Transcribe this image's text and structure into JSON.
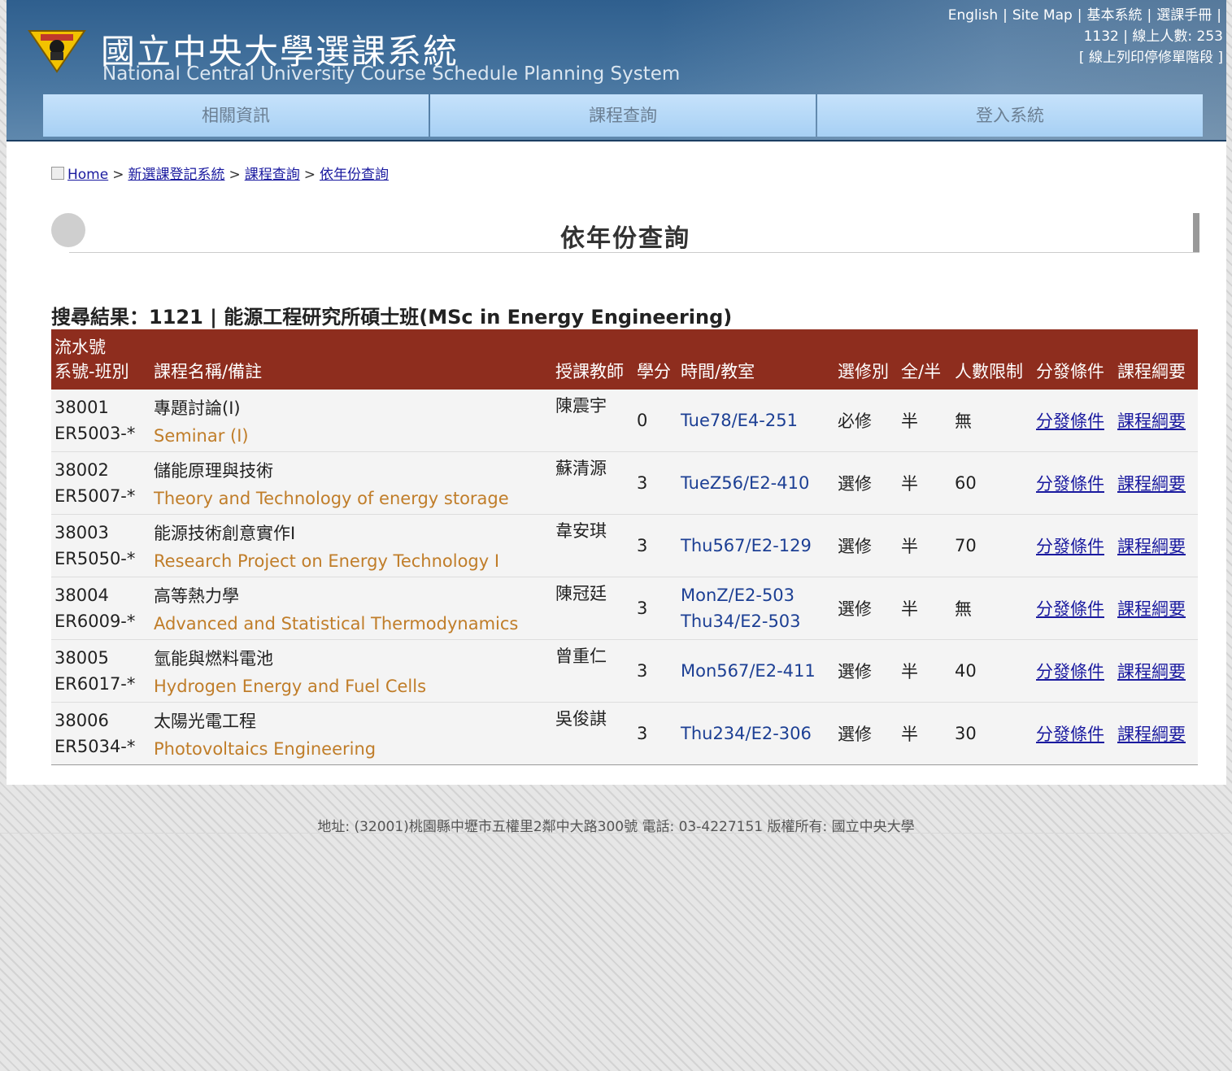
{
  "header": {
    "title_zh": "國立中央大學選課系統",
    "title_en": "National Central University Course Schedule Planning System",
    "top_links": [
      "English",
      "Site Map",
      "基本系統",
      "選課手冊"
    ],
    "online": "1132 | 線上人數: 253",
    "print_stop": "[ 線上列印停修單階段 ]"
  },
  "nav": [
    "相關資訊",
    "課程查詢",
    "登入系統"
  ],
  "breadcrumb": [
    "Home",
    "新選課登記系統",
    "課程查詢",
    "依年份查詢"
  ],
  "section_title": "依年份查詢",
  "result_title": "搜尋結果：1121 | 能源工程研究所碩士班(MSc in Energy Engineering)",
  "table": {
    "headers": [
      "流水號",
      "系號-班別",
      "課程名稱/備註",
      "授課教師",
      "學分",
      "時間/教室",
      "選修別",
      "全/半",
      "人數限制",
      "分發條件",
      "課程綱要"
    ],
    "link_condition": "分發條件",
    "link_outline": "課程綱要",
    "rows": [
      {
        "serial": "38001",
        "code": "ER5003-*",
        "name_zh": "專題討論(I)",
        "name_en": "Seminar (I)",
        "teacher": "陳震宇",
        "credit": "0",
        "time": "Tue78/E4-251",
        "type": "必修",
        "half": "半",
        "limit": "無"
      },
      {
        "serial": "38002",
        "code": "ER5007-*",
        "name_zh": "儲能原理與技術",
        "name_en": "Theory and Technology of energy storage",
        "teacher": "蘇清源",
        "credit": "3",
        "time": "TueZ56/E2-410",
        "type": "選修",
        "half": "半",
        "limit": "60"
      },
      {
        "serial": "38003",
        "code": "ER5050-*",
        "name_zh": "能源技術創意實作I",
        "name_en": "Research Project on Energy Technology I",
        "teacher": "韋安琪",
        "credit": "3",
        "time": "Thu567/E2-129",
        "type": "選修",
        "half": "半",
        "limit": "70"
      },
      {
        "serial": "38004",
        "code": "ER6009-*",
        "name_zh": "高等熱力學",
        "name_en": "Advanced and Statistical Thermodynamics",
        "teacher": "陳冠廷",
        "credit": "3",
        "time": "MonZ/E2-503",
        "time2": "Thu34/E2-503",
        "type": "選修",
        "half": "半",
        "limit": "無"
      },
      {
        "serial": "38005",
        "code": "ER6017-*",
        "name_zh": "氫能與燃料電池",
        "name_en": "Hydrogen Energy and Fuel Cells",
        "teacher": "曾重仁",
        "credit": "3",
        "time": "Mon567/E2-411",
        "type": "選修",
        "half": "半",
        "limit": "40"
      },
      {
        "serial": "38006",
        "code": "ER5034-*",
        "name_zh": "太陽光電工程",
        "name_en": "Photovoltaics Engineering",
        "teacher": "吳俊諆",
        "credit": "3",
        "time": "Thu234/E2-306",
        "type": "選修",
        "half": "半",
        "limit": "30"
      }
    ]
  },
  "footer": "地址: (32001)桃園縣中壢市五權里2鄰中大路300號 電話: 03-4227151 版權所有: 國立中央大學",
  "colors": {
    "header_bg": "#46749f",
    "table_header": "#8e2d1e",
    "english_name": "#c07d29",
    "link": "#1a1a9f"
  }
}
